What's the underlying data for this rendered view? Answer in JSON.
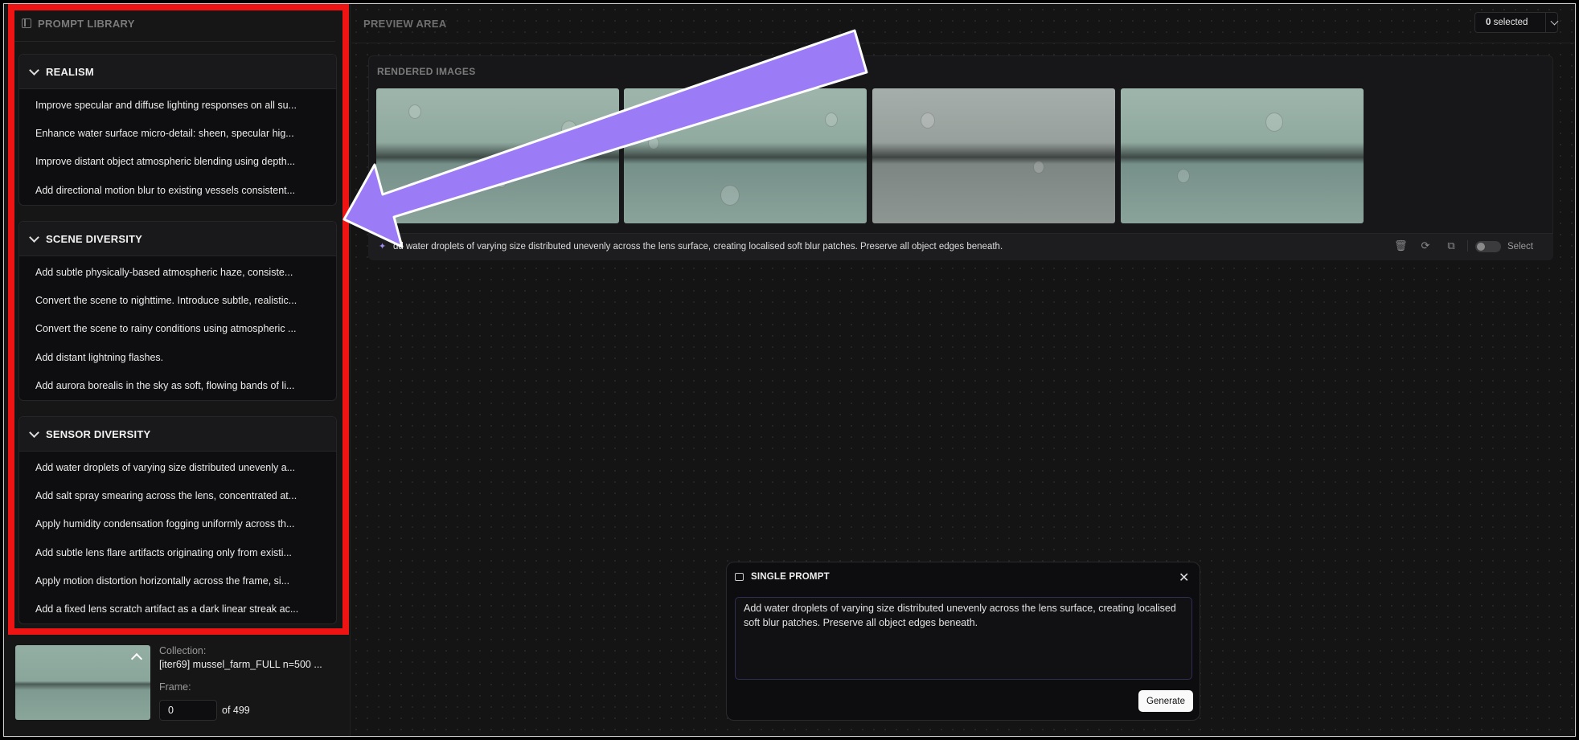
{
  "sidebar": {
    "title": "PROMPT LIBRARY",
    "categories": [
      {
        "label": "REALISM",
        "items": [
          "Improve specular and diffuse lighting responses on all su...",
          "Enhance water surface micro-detail: sheen, specular hig...",
          "Improve distant object atmospheric blending using depth...",
          "Add directional motion blur to existing vessels consistent..."
        ]
      },
      {
        "label": "SCENE DIVERSITY",
        "items": [
          "Add subtle physically-based atmospheric haze, consiste...",
          "Convert the scene to nighttime. Introduce subtle, realistic...",
          "Convert the scene to rainy conditions using atmospheric ...",
          "Add distant lightning flashes.",
          "Add aurora borealis in the sky as soft, flowing bands of li..."
        ]
      },
      {
        "label": "SENSOR DIVERSITY",
        "items": [
          "Add water droplets of varying size distributed unevenly a...",
          "Add salt spray smearing across the lens, concentrated at...",
          "Apply humidity condensation fogging uniformly across th...",
          "Add subtle lens flare artifacts originating only from existi...",
          "Apply motion distortion horizontally across the frame, si...",
          "Add a fixed lens scratch artifact as a dark linear streak ac..."
        ]
      }
    ],
    "collection": {
      "label": "Collection:",
      "name": "[iter69] mussel_farm_FULL n=500 ...",
      "frame_label": "Frame:",
      "frame_value": "0",
      "frame_total": "of 499"
    }
  },
  "main": {
    "title": "PREVIEW AREA",
    "selected_count": "0",
    "selected_suffix": "selected",
    "rendered": {
      "title": "RENDERED IMAGES",
      "images": [
        "rendered-image-1",
        "rendered-image-2",
        "rendered-image-3",
        "rendered-image-4"
      ],
      "prompt_text": "dd water droplets of varying size distributed unevenly across the lens surface, creating localised soft blur patches. Preserve all object edges beneath.",
      "select_label": "Select"
    }
  },
  "single_prompt": {
    "title": "SINGLE PROMPT",
    "text": "Add water droplets of varying size distributed unevenly across the lens surface, creating localised soft blur patches. Preserve all object edges beneath.",
    "generate_label": "Generate"
  },
  "annotation": {
    "highlight_color": "#ef1414",
    "arrow_color": "#9b7cf6"
  }
}
